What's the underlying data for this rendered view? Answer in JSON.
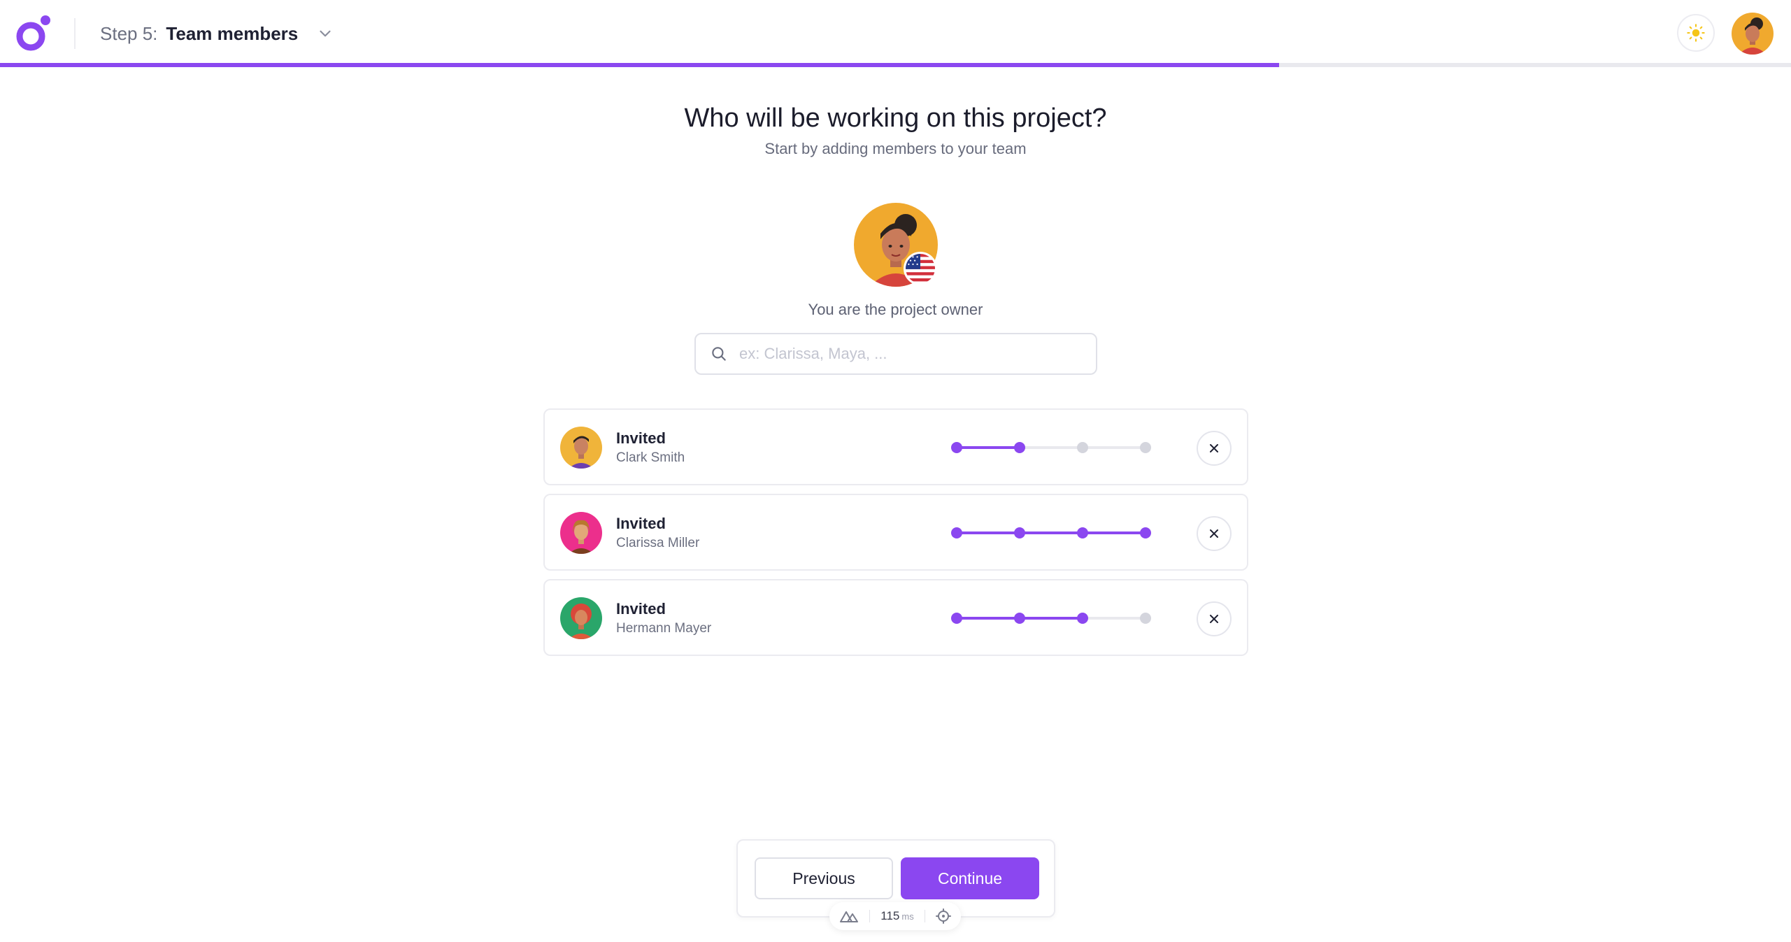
{
  "header": {
    "step_prefix": "Step 5:",
    "step_title": "Team members",
    "progress_fraction": 0.714
  },
  "colors": {
    "accent": "#8b47f0",
    "track": "#e9e9ee",
    "inactive_dot": "#d4d5dd"
  },
  "main": {
    "heading": "Who will be working on this project?",
    "subheading": "Start by adding members to your team",
    "owner_label": "You are the project owner",
    "owner_flag": "us-flag-icon"
  },
  "search": {
    "placeholder": "ex: Clarissa, Maya, ...",
    "value": ""
  },
  "members": [
    {
      "status": "Invited",
      "name": "Clark Smith",
      "avatar_bg": "#f0b43a",
      "steps_total": 4,
      "steps_done": 2
    },
    {
      "status": "Invited",
      "name": "Clarissa Miller",
      "avatar_bg": "#ec2f8c",
      "steps_total": 4,
      "steps_done": 4
    },
    {
      "status": "Invited",
      "name": "Hermann Mayer",
      "avatar_bg": "#2aa66a",
      "steps_total": 4,
      "steps_done": 3
    }
  ],
  "footer": {
    "previous_label": "Previous",
    "continue_label": "Continue"
  },
  "devtools": {
    "time": "115",
    "unit": "ms"
  }
}
